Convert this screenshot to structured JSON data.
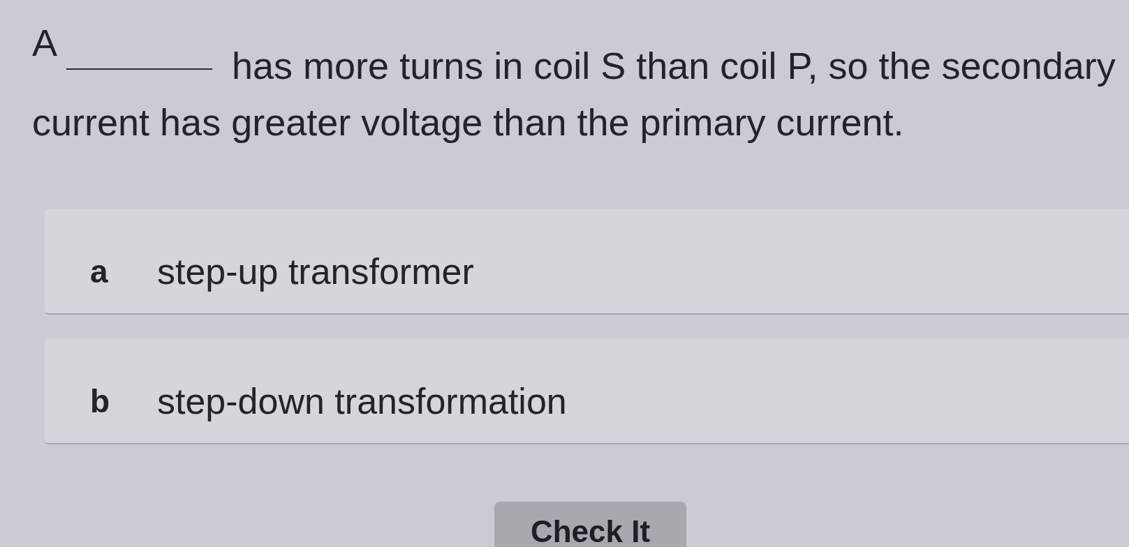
{
  "question": {
    "prefix": "A",
    "lines": [
      "has more turns in coil S than coil P, so the secondary",
      "current has greater voltage than the primary current."
    ]
  },
  "options": [
    {
      "letter": "a",
      "label": "step-up transformer"
    },
    {
      "letter": "b",
      "label": "step-down transformation"
    }
  ],
  "check_button": {
    "label": "Check It"
  }
}
